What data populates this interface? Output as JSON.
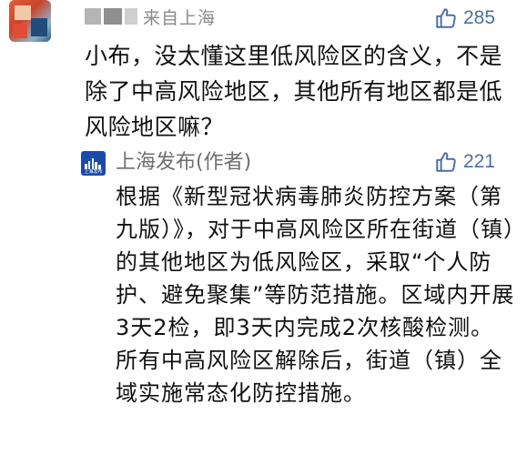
{
  "comment": {
    "username_visible": "来自上海",
    "likes": "285",
    "text": "小布，没太懂这里低风险区的含义，不是除了中高风险地区，其他所有地区都是低风险地区嘛？"
  },
  "reply": {
    "author": "上海发布(作者)",
    "logo_text": "上海发布",
    "likes": "221",
    "text": "根据《新型冠状病毒肺炎防控方案（第九版）》，对于中高风险区所在街道（镇）的其他地区为低风险区，采取“个人防护、避免聚集”等防范措施。区域内开展3天2检，即3天内完成2次核酸检测。所有中高风险区解除后，街道（镇）全域实施常态化防控措施。"
  },
  "icons": {
    "like": "thumbs-up-icon",
    "avatar": "user-avatar",
    "reply_logo": "shanghai-fabu-logo"
  },
  "colors": {
    "like_blue": "#4a6fa5",
    "logo_blue": "#1b4aa6",
    "meta_gray": "#8a8a8a"
  }
}
